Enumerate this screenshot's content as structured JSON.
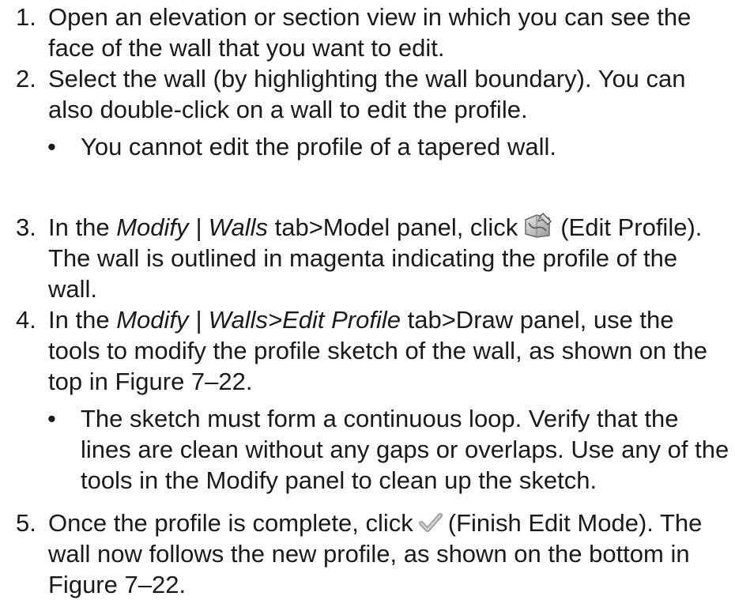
{
  "steps": [
    {
      "number": "1.",
      "text": "Open an elevation or section view in which you can see the face of the wall that you want to edit."
    },
    {
      "number": "2.",
      "text": "Select the wall (by highlighting the wall boundary). You can also double-click on a wall to edit the profile.",
      "note": "You cannot edit the profile of a tapered wall."
    },
    {
      "number": "3.",
      "pre": "In the ",
      "em": "Modify | Walls",
      "mid": " tab>Model panel, click",
      "icon": "edit-profile-icon",
      "post": "(Edit Profile). The wall is outlined in magenta indicating the profile of the wall."
    },
    {
      "number": "4.",
      "pre": "In the ",
      "em": "Modify | Walls>Edit Profile",
      "post": " tab>Draw panel, use the tools to modify the profile sketch of the wall, as shown on the top in Figure 7–22.",
      "note": "The sketch must form a continuous loop. Verify that the lines are clean without any gaps or overlaps. Use any of the tools in the Modify panel to clean up the sketch."
    },
    {
      "number": "5.",
      "pre": "Once the profile is complete, click",
      "icon": "finish-edit-mode-icon",
      "post": "(Finish Edit Mode). The wall now follows the new profile, as shown on the bottom in Figure 7–22."
    }
  ],
  "bullet": "•"
}
